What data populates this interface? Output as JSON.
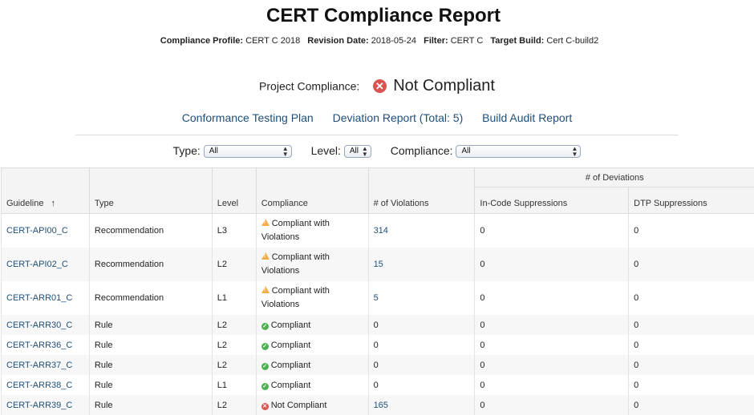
{
  "report": {
    "title": "CERT Compliance Report",
    "meta": [
      {
        "label": "Compliance Profile:",
        "value": "CERT C 2018"
      },
      {
        "label": "Revision Date:",
        "value": "2018-05-24"
      },
      {
        "label": "Filter:",
        "value": "CERT C"
      },
      {
        "label": "Target Build:",
        "value": "Cert C-build2"
      }
    ],
    "project_compliance_label": "Project Compliance:",
    "project_compliance_value": "Not Compliant",
    "status_colors": {
      "compliant": "#4caf50",
      "not_compliant": "#d9534f",
      "warning": "#f0ad4e"
    }
  },
  "links": {
    "conformance": "Conformance Testing Plan",
    "deviation": "Deviation Report (Total: 5)",
    "audit": "Build Audit Report"
  },
  "filters": {
    "type_label": "Type:",
    "type_value": "All",
    "level_label": "Level:",
    "level_value": "All",
    "compliance_label": "Compliance:",
    "compliance_value": "All"
  },
  "table": {
    "headers": {
      "guideline": "Guideline",
      "type": "Type",
      "level": "Level",
      "compliance": "Compliance",
      "violations": "# of Violations",
      "deviations_group": "# of Deviations",
      "in_code": "In-Code Suppressions",
      "dtp": "DTP Suppressions"
    },
    "rows": [
      {
        "guideline": "CERT-API00_C",
        "type": "Recommendation",
        "level": "L3",
        "status": "warn",
        "compliance": "Compliant with Violations",
        "violations": "314",
        "in_code": "0",
        "dtp": "0"
      },
      {
        "guideline": "CERT-API02_C",
        "type": "Recommendation",
        "level": "L2",
        "status": "warn",
        "compliance": "Compliant with Violations",
        "violations": "15",
        "in_code": "0",
        "dtp": "0"
      },
      {
        "guideline": "CERT-ARR01_C",
        "type": "Recommendation",
        "level": "L1",
        "status": "warn",
        "compliance": "Compliant with Violations",
        "violations": "5",
        "in_code": "0",
        "dtp": "0"
      },
      {
        "guideline": "CERT-ARR30_C",
        "type": "Rule",
        "level": "L2",
        "status": "ok",
        "compliance": "Compliant",
        "violations": "0",
        "in_code": "0",
        "dtp": "0"
      },
      {
        "guideline": "CERT-ARR36_C",
        "type": "Rule",
        "level": "L2",
        "status": "ok",
        "compliance": "Compliant",
        "violations": "0",
        "in_code": "0",
        "dtp": "0"
      },
      {
        "guideline": "CERT-ARR37_C",
        "type": "Rule",
        "level": "L2",
        "status": "ok",
        "compliance": "Compliant",
        "violations": "0",
        "in_code": "0",
        "dtp": "0"
      },
      {
        "guideline": "CERT-ARR38_C",
        "type": "Rule",
        "level": "L1",
        "status": "ok",
        "compliance": "Compliant",
        "violations": "0",
        "in_code": "0",
        "dtp": "0"
      },
      {
        "guideline": "CERT-ARR39_C",
        "type": "Rule",
        "level": "L2",
        "status": "bad",
        "compliance": "Not Compliant",
        "violations": "165",
        "in_code": "0",
        "dtp": "0"
      }
    ]
  }
}
